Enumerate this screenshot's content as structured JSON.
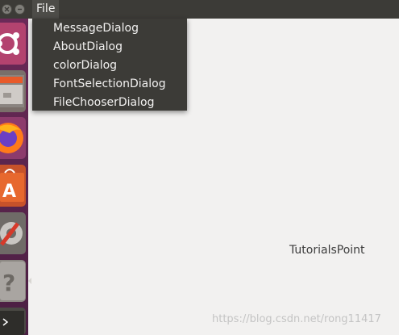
{
  "menubar": {
    "file_label": "File"
  },
  "file_menu": {
    "items": [
      {
        "label": "MessageDialog"
      },
      {
        "label": "AboutDialog"
      },
      {
        "label": "colorDialog"
      },
      {
        "label": "FontSelectionDialog"
      },
      {
        "label": "FileChooserDialog"
      }
    ]
  },
  "content": {
    "label": "TutorialsPoint"
  },
  "watermark": "https://blog.csdn.net/rong11417",
  "launcher": {
    "icons": [
      "ubuntu-dash-icon",
      "files-icon",
      "firefox-icon",
      "software-center-icon",
      "system-settings-icon",
      "help-icon",
      "terminal-icon"
    ]
  },
  "colors": {
    "panel": "#3c3b37",
    "launcher": "#5e2750",
    "window_bg": "#f2f1f0"
  }
}
